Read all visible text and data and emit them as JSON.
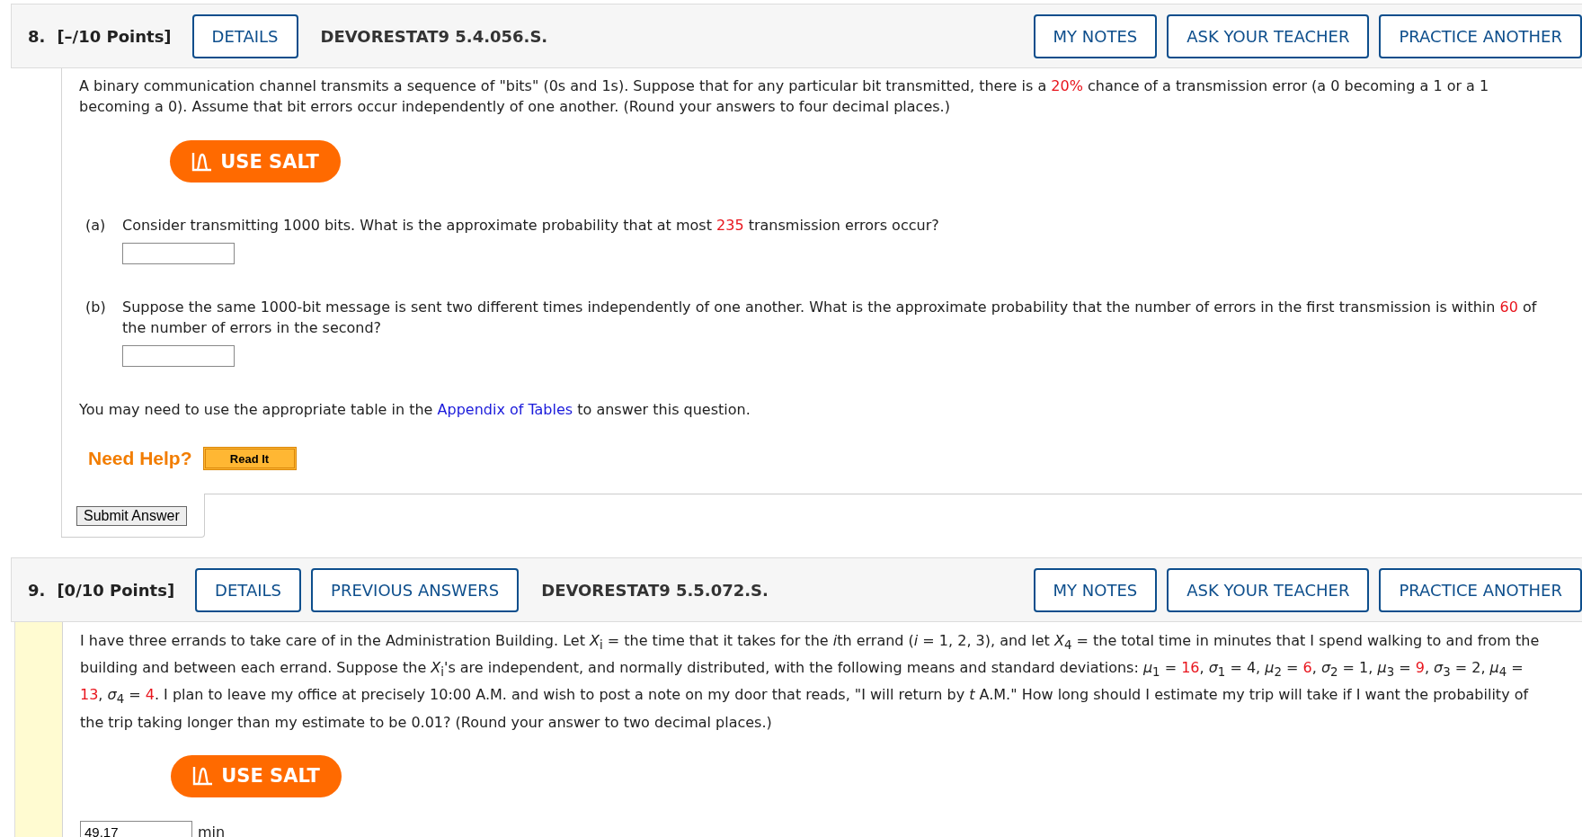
{
  "questions": [
    {
      "number": "8.",
      "points": "[–/10 Points]",
      "buttons": [
        "DETAILS"
      ],
      "code": "DEVORESTAT9 5.4.056.S.",
      "actions": [
        "MY NOTES",
        "ASK YOUR TEACHER",
        "PRACTICE ANOTHER"
      ],
      "highlighted": false,
      "body": [
        {
          "kind": "paragraph",
          "segments": [
            {
              "kind": "text",
              "text": "A binary communication channel transmits a sequence of \"bits\" (0s and 1s). Suppose that for any particular bit transmitted, there is a "
            },
            {
              "kind": "value",
              "text": "20%"
            },
            {
              "kind": "text",
              "text": " chance of a transmission error (a 0 becoming a 1 or a 1 becoming a 0). Assume that bit errors occur independently of one another. (Round your answers to four decimal places.)"
            }
          ]
        },
        {
          "kind": "salt",
          "label": "USE SALT"
        },
        {
          "kind": "part",
          "label": "(a)",
          "segments": [
            {
              "kind": "text",
              "text": "Consider transmitting 1000 bits. What is the approximate probability that at most "
            },
            {
              "kind": "value",
              "text": "235"
            },
            {
              "kind": "text",
              "text": " transmission errors occur?"
            }
          ]
        },
        {
          "kind": "part",
          "label": "(b)",
          "segments": [
            {
              "kind": "text",
              "text": "Suppose the same 1000-bit message is sent two different times independently of one another. What is the approximate probability that the number of errors in the first transmission is within "
            },
            {
              "kind": "value",
              "text": "60"
            },
            {
              "kind": "text",
              "text": " of the number of errors in the second?"
            }
          ]
        },
        {
          "kind": "paragraph",
          "segments": [
            {
              "kind": "text",
              "text": "You may need to use the appropriate table in the "
            },
            {
              "kind": "link",
              "text": "Appendix of Tables"
            },
            {
              "kind": "text",
              "text": " to answer this question."
            }
          ]
        },
        {
          "kind": "help",
          "label": "Need Help?",
          "buttons": [
            "Read It"
          ]
        },
        {
          "kind": "submit",
          "label": "Submit Answer"
        }
      ]
    },
    {
      "number": "9.",
      "points": "[0/10 Points]",
      "buttons": [
        "DETAILS",
        "PREVIOUS ANSWERS"
      ],
      "code": "DEVORESTAT9 5.5.072.S.",
      "actions": [
        "MY NOTES",
        "ASK YOUR TEACHER",
        "PRACTICE ANOTHER"
      ],
      "highlighted": true,
      "body": [
        {
          "kind": "paragraph",
          "segments": [
            {
              "kind": "text",
              "text": "I have three errands to take care of in the Administration Building. Let *X*$_{i}$ = the time that it takes for the "
            },
            {
              "kind": "italic",
              "text": "i"
            },
            {
              "kind": "text",
              "text": "th errand (*i* = 1, 2, 3), and let *X*$_{4}$ = the total time in minutes that I spend walking to and from the building and between each errand. Suppose the *X*$_{i}$'s are independent, and normally distributed, with the following means and standard deviations: *μ*$_{1}$ = "
            },
            {
              "kind": "value",
              "text": "16"
            },
            {
              "kind": "text",
              "text": ", *σ*$_{1}$ = 4, *μ*$_{2}$ = "
            },
            {
              "kind": "value",
              "text": "6"
            },
            {
              "kind": "text",
              "text": ", *σ*$_{2}$ = 1, *μ*$_{3}$ = "
            },
            {
              "kind": "value",
              "text": "9"
            },
            {
              "kind": "text",
              "text": ", *σ*$_{3}$ = 2, *μ*$_{4}$ = "
            },
            {
              "kind": "value",
              "text": "13"
            },
            {
              "kind": "text",
              "text": ", *σ*$_{4}$ = "
            },
            {
              "kind": "value",
              "text": "4"
            },
            {
              "kind": "text",
              "text": ". I plan to leave my office at precisely 10:00 A.M. and wish to post a note on my door that reads, \"I will return by *t* A.M.\" How long should I estimate my trip will take if I want the probability of the trip taking longer than my estimate to be 0.01? (Round your answer to two decimal places.)"
            }
          ]
        },
        {
          "kind": "salt",
          "label": "USE SALT"
        },
        {
          "kind": "answer",
          "value": "49.17",
          "unit": "min"
        }
      ]
    }
  ]
}
